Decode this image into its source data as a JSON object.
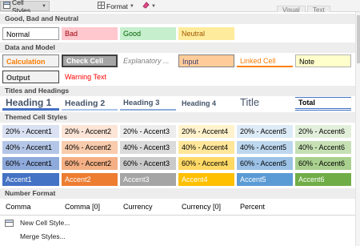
{
  "toolbar": {
    "cell_styles_label": "Cell Styles",
    "format_label": "Format",
    "tab_visual": "Visual",
    "tab_text": "Text"
  },
  "sections": {
    "good_bad": "Good, Bad and Neutral",
    "data_model": "Data and Model",
    "titles": "Titles and Headings",
    "themed": "Themed Cell Styles",
    "number": "Number Format"
  },
  "good_bad": [
    "Normal",
    "Bad",
    "Good",
    "Neutral"
  ],
  "data_model_row1": [
    "Calculation",
    "Check Cell",
    "Explanatory ...",
    "Input",
    "Linked Cell",
    "Note"
  ],
  "data_model_row2": [
    "Output",
    "Warning Text"
  ],
  "titles": [
    "Heading 1",
    "Heading 2",
    "Heading 3",
    "Heading 4",
    "Title",
    "Total"
  ],
  "themed_20": [
    "20% - Accent1",
    "20% - Accent2",
    "20% - Accent3",
    "20% - Accent4",
    "20% - Accent5",
    "20% - Accent6"
  ],
  "themed_40": [
    "40% - Accent1",
    "40% - Accent2",
    "40% - Accent3",
    "40% - Accent4",
    "40% - Accent5",
    "40% - Accent6"
  ],
  "themed_60": [
    "60% - Accent1",
    "60% - Accent2",
    "60% - Accent3",
    "60% - Accent4",
    "60% - Accent5",
    "60% - Accent6"
  ],
  "themed_solid": [
    "Accent1",
    "Accent2",
    "Accent3",
    "Accent4",
    "Accent5",
    "Accent6"
  ],
  "number_format": [
    "Comma",
    "Comma [0]",
    "Currency",
    "Currency [0]",
    "Percent"
  ],
  "menu": {
    "new_cell_style": "New Cell Style...",
    "merge_styles": "Merge Styles..."
  },
  "colors": {
    "accent1": "#4472c4",
    "accent2": "#ed7d31",
    "accent3": "#a5a5a5",
    "accent4": "#ffc000",
    "accent5": "#5b9bd5",
    "accent6": "#70ad47"
  },
  "icons": {
    "cell_styles": "cell-styles-icon",
    "format": "format-icon",
    "clear": "eraser-icon",
    "new_style": "new-style-icon",
    "merge": "merge-icon"
  }
}
